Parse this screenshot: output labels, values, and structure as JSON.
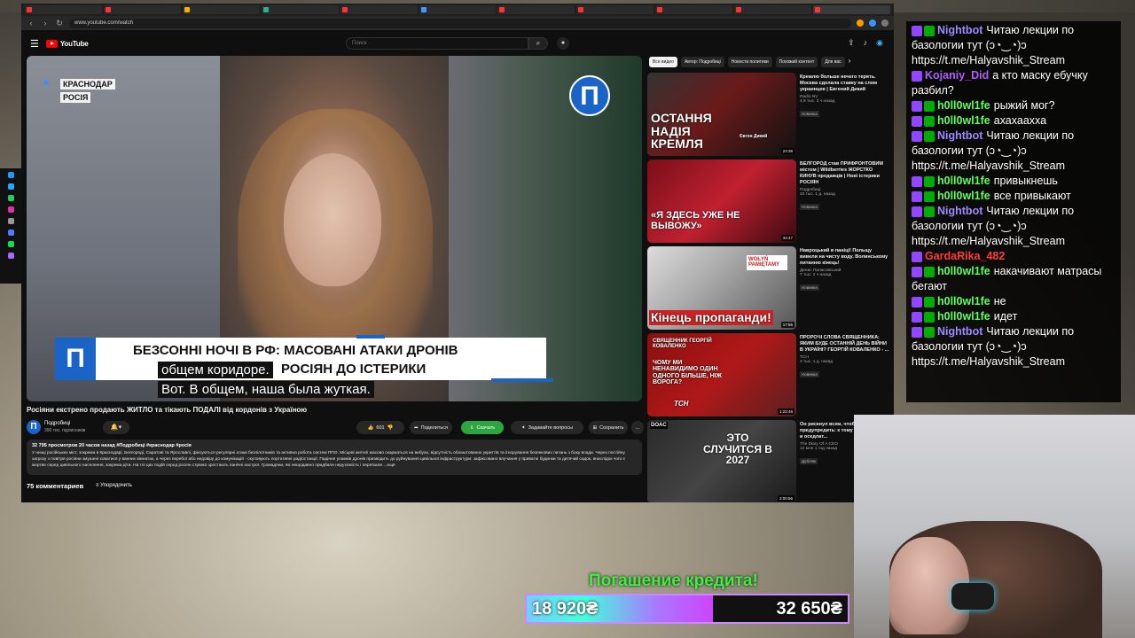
{
  "browser": {
    "url": "www.youtube.com/watch"
  },
  "youtube": {
    "logo_text": "YouTube",
    "search_placeholder": "Поиск"
  },
  "video": {
    "location_line1": "КРАСНОДАР",
    "location_line2": "РОСІЯ",
    "channel_logo_letter": "П",
    "lower_third_line1": "БЕЗСОННІ НОЧІ В РФ: МАСОВАНІ АТАКИ ДРОНІВ",
    "lower_third_line2": "РОСІЯН ДО ІСТЕРИКИ",
    "subtitle1": "общем коридоре.",
    "subtitle2": "Вот. В общем, наша была жуткая."
  },
  "info": {
    "title": "Росіяни екстрено продають ЖИТЛО та тікають ПОДАЛІ від кордонів з Україною",
    "channel": "Подробиці",
    "subscribers": "390 тис. підписників",
    "likes": "601",
    "share_label": "Поделиться",
    "download_label": "Скачать",
    "ask_label": "Задавайте вопросы",
    "save_label": "Сохранить",
    "more_label": "...",
    "desc_meta": "32 795 просмотров  20 часов назад  #Подробиці #краснодар #росія",
    "desc_text": "У низці російських міст, зокрема в Краснодарі, Белгороді, Саратові та Ярославлі, фіксуються регулярні атаки безпілотників та активна робота систем ППО. Місцеві жителі масово скаржаться на вибухи, відсутність облаштованих укриттів та ігнорування безпекових питань з боку влади. Через постійну загрозу з повітря росіяни змушені ховатися у ванних кімнатах, а через перебої або недовіру до комунікацій - скуповують портативні радіостанції. Падіння уламків дронів призводить до руйнування цивільної інфраструктури: зафіксовано влучання у приватні будинки та дитячий садок, внаслідок чого є жертви серед цивільного населення, зокрема діти. На тлі цих подій серед росіян стрімко зростають панічні настрої. Громадяни, які нещодавно придбали нерухомість і переїхали ...ещё",
    "comments_count": "75 комментариев",
    "sort_label": "Упорядочить"
  },
  "chips": [
    "Все видео",
    "Автор: Подробиці",
    "Новости политики",
    "Похожий контент",
    "Для вас"
  ],
  "recommendations": [
    {
      "title": "Кремлю больше нечего терять. Москва сделала ставку на слом украинцев | Евгений Дикий",
      "channel": "Radio NV",
      "views": "4,9 тыс.  2 ч назад",
      "badge": "Новинка",
      "duration": "23:38",
      "thumb_text": "ОСТАННЯ НАДІЯ КРЕМЛЯ",
      "thumb_name": "Євген Дикий"
    },
    {
      "title": "БЕЛГОРОД став ПРИФРОНТОВИМ містом | Wildberries ЖОРСТКО КИНУВ продавців | Нові істерики РОСІЯН",
      "channel": "Подробиці",
      "views": "10 тыс.  1 д. назад",
      "badge": "Новинка",
      "duration": "34:47",
      "thumb_text": "«Я ЗДЕСЬ УЖЕ НЕ ВЫВОЖУ»"
    },
    {
      "title": "Навроцький в паніці! Польщу вивели на чисту воду. Волинському питанню кінець!",
      "channel": "Денис Панасовський",
      "views": "7 тыс.  2 ч назад",
      "badge": "Новинка",
      "duration": "17:55",
      "thumb_text": "Кінець пропаганди!",
      "thumb_sign": "WOŁYŃ PAMIĘTAMY"
    },
    {
      "title": "ПРОРОЧІ СЛОВА СВЯЩЕННИКА: ЯКИМ БУДЕ ОСТАННІЙ ДЕНЬ ВІЙНИ В УКРАЇНІ? ГЕОРГІЙ КОВАЛЕНКО - ...",
      "channel": "ТСН",
      "views": "4 тыс.  1 д. назад",
      "badge": "Новинка",
      "duration": "1:22:46",
      "thumb_text": "ЧОМУ МИ НЕНАВИДИМО ОДИН ОДНОГО БІЛЬШЕ, НІЖ ВОРОГА?",
      "thumb_caption": "СВЯЩЕННИК ГЕОРГІЙ КОВАЛЕНКО",
      "thumb_brand": "ТСН"
    },
    {
      "title": "Он рискнул всем, чтобы предупредить: к тому ... готов никто, и оседлат...",
      "channel": "The Diary Of A CEO",
      "views": "12 млн  1 год назад",
      "badge": "Дубляж",
      "duration": "2:00:56",
      "thumb_text": "ЭТО СЛУЧИТСЯ В 2027",
      "thumb_brand": "DOAC"
    }
  ],
  "chat": [
    {
      "user": "Nightbot",
      "color": "#9b8cff",
      "text": "Читаю лекции по базологии тут (ↄ◔‿◔)ↄ https://t.me/Halyavshik_Stream"
    },
    {
      "user": "Kojaniy_Did",
      "color": "#b05cff",
      "text": "а кто маску ебучку разбил?"
    },
    {
      "user": "h0ll0wl1fe",
      "color": "#5cff5c",
      "text": "рыжий мог?"
    },
    {
      "user": "h0ll0wl1fe",
      "color": "#5cff5c",
      "text": "ахахаахха"
    },
    {
      "user": "Nightbot",
      "color": "#9b8cff",
      "text": "Читаю лекции по базологии тут (ↄ◔‿◔)ↄ https://t.me/Halyavshik_Stream"
    },
    {
      "user": "h0ll0wl1fe",
      "color": "#5cff5c",
      "text": "привыкнешь"
    },
    {
      "user": "h0ll0wl1fe",
      "color": "#5cff5c",
      "text": "все привыкают"
    },
    {
      "user": "Nightbot",
      "color": "#9b8cff",
      "text": "Читаю лекции по базологии тут (ↄ◔‿◔)ↄ https://t.me/Halyavshik_Stream"
    },
    {
      "user": "GardaRika_482",
      "color": "#ff3b3b",
      "text": ""
    },
    {
      "user": "h0ll0wl1fe",
      "color": "#5cff5c",
      "text": "накачивают матрасы бегают"
    },
    {
      "user": "h0ll0wl1fe",
      "color": "#5cff5c",
      "text": "не"
    },
    {
      "user": "h0ll0wl1fe",
      "color": "#5cff5c",
      "text": "идет"
    },
    {
      "user": "Nightbot",
      "color": "#9b8cff",
      "text": "Читаю лекции по базологии тут (ↄ◔‿◔)ↄ https://t.me/Halyavshik_Stream"
    }
  ],
  "goal": {
    "label": "Погашение кредита!",
    "current": "18 920₴",
    "target": "32 650₴",
    "progress_fraction": 0.58
  },
  "colors": {
    "youtube_red": "#ff0000",
    "brand_blue": "#1a64c8",
    "download_green": "#2ba640",
    "goal_green": "#3df03d"
  }
}
